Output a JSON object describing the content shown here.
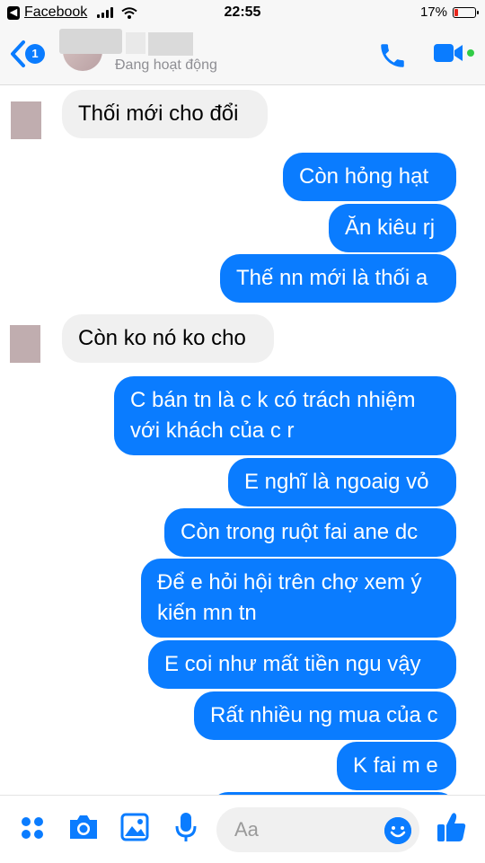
{
  "status_bar": {
    "back_app_label": "Facebook",
    "time": "22:55",
    "battery_percent": "17%",
    "battery_level": 0.17
  },
  "header": {
    "unread_count": "1",
    "status_text": "Đang hoạt động"
  },
  "messages": [
    {
      "direction": "in",
      "text": "Thối mới cho đổi"
    },
    {
      "direction": "out",
      "text": "Còn hỏng hạt"
    },
    {
      "direction": "out",
      "text": "Ăn kiêu rj"
    },
    {
      "direction": "out",
      "text": "Thế nn mới là thối a"
    },
    {
      "direction": "in",
      "text": "Còn ko nó ko cho"
    },
    {
      "direction": "out",
      "text": "C bán tn là c k có trách nhiệm\nvới khách của c r"
    },
    {
      "direction": "out",
      "text": "E nghĩ là ngoaig vỏ"
    },
    {
      "direction": "out",
      "text": "Còn trong ruột fai ane dc"
    },
    {
      "direction": "out",
      "text": "Để e hỏi hội trên chợ xem ý\nkiến mn tn"
    },
    {
      "direction": "out",
      "text": "E coi như mất tiền ngu vậy"
    },
    {
      "direction": "out",
      "text": "Rất nhiều ng mua của c"
    },
    {
      "direction": "out",
      "text": "K fai m e"
    }
  ],
  "composer": {
    "placeholder": "Aa"
  },
  "colors": {
    "accent": "#0a7cff",
    "incoming_bubble": "#f0f0f0",
    "online": "#31cc46",
    "battery_low": "#e8261c"
  },
  "icons": [
    "back-chevron-icon",
    "phone-icon",
    "video-camera-icon",
    "apps-grid-icon",
    "camera-icon",
    "photo-icon",
    "microphone-icon",
    "emoji-icon",
    "thumbs-up-icon"
  ]
}
